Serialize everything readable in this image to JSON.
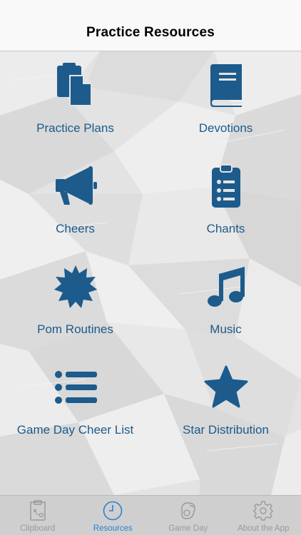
{
  "navbar": {
    "title": "Practice Resources"
  },
  "colors": {
    "accent": "#1c5b8c",
    "tab_active": "#2d7fd3",
    "tab_inactive": "#9a9a9a"
  },
  "resources": [
    {
      "label": "Practice Plans",
      "icon": "documents-icon"
    },
    {
      "label": "Devotions",
      "icon": "book-icon"
    },
    {
      "label": "Cheers",
      "icon": "megaphone-icon"
    },
    {
      "label": "Chants",
      "icon": "clipboard-list-icon"
    },
    {
      "label": "Pom Routines",
      "icon": "pom-burst-icon"
    },
    {
      "label": "Music",
      "icon": "music-note-icon"
    },
    {
      "label": "Game Day Cheer List",
      "icon": "list-icon"
    },
    {
      "label": "Star Distribution",
      "icon": "star-icon"
    }
  ],
  "tabbar": {
    "tabs": [
      {
        "label": "Clipboard",
        "icon": "clipboard-icon",
        "active": false
      },
      {
        "label": "Resources",
        "icon": "clock-icon",
        "active": true
      },
      {
        "label": "Game Day",
        "icon": "whistle-icon",
        "active": false
      },
      {
        "label": "About the App",
        "icon": "gear-icon",
        "active": false
      }
    ]
  }
}
